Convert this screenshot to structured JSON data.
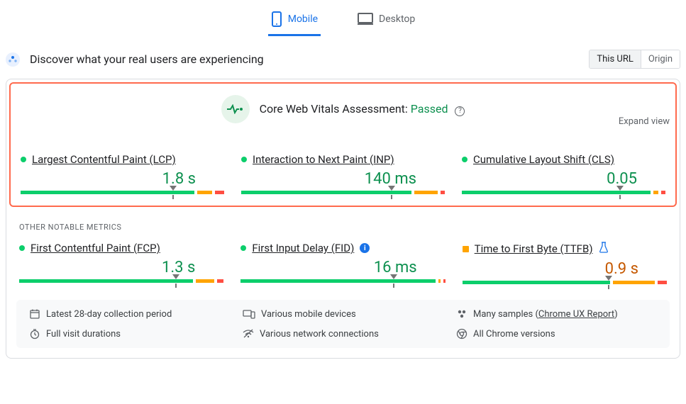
{
  "tabs": {
    "mobile": "Mobile",
    "desktop": "Desktop"
  },
  "header": {
    "title": "Discover what your real users are experiencing",
    "scope_this_url": "This URL",
    "scope_origin": "Origin"
  },
  "assessment": {
    "label": "Core Web Vitals Assessment: ",
    "status": "Passed",
    "expand": "Expand view"
  },
  "core_metrics": [
    {
      "name": "Largest Contentful Paint (LCP)",
      "value": "1.8 s",
      "status": "good",
      "seg_g": 78,
      "seg_o": 7,
      "seg_r": 4,
      "marker": 73
    },
    {
      "name": "Interaction to Next Paint (INP)",
      "value": "140 ms",
      "status": "good",
      "seg_g": 74,
      "seg_o": 10,
      "seg_r": 2,
      "marker": 72
    },
    {
      "name": "Cumulative Layout Shift (CLS)",
      "value": "0.05",
      "status": "good",
      "seg_g": 85,
      "seg_o": 2,
      "seg_r": 2,
      "marker": 76
    }
  ],
  "other_label": "OTHER NOTABLE METRICS",
  "other_metrics": [
    {
      "name": "First Contentful Paint (FCP)",
      "value": "1.3 s",
      "status": "good",
      "dot": "green",
      "extra": "",
      "seg_g": 77,
      "seg_o": 8,
      "seg_r": 3,
      "marker": 75
    },
    {
      "name": "First Input Delay (FID)",
      "value": "16 ms",
      "status": "good",
      "dot": "green",
      "extra": "info",
      "seg_g": 96,
      "seg_o": 1,
      "seg_r": 1,
      "marker": 73
    },
    {
      "name": "Time to First Byte (TTFB)",
      "value": "0.9 s",
      "status": "warn",
      "dot": "orange",
      "extra": "flask",
      "seg_g": 64,
      "seg_o": 18,
      "seg_r": 4,
      "marker": 70
    }
  ],
  "footer": {
    "period": "Latest 28-day collection period",
    "devices": "Various mobile devices",
    "samples_pre": "Many samples (",
    "samples_link": "Chrome UX Report",
    "samples_post": ")",
    "durations": "Full visit durations",
    "network": "Various network connections",
    "versions": "All Chrome versions"
  }
}
